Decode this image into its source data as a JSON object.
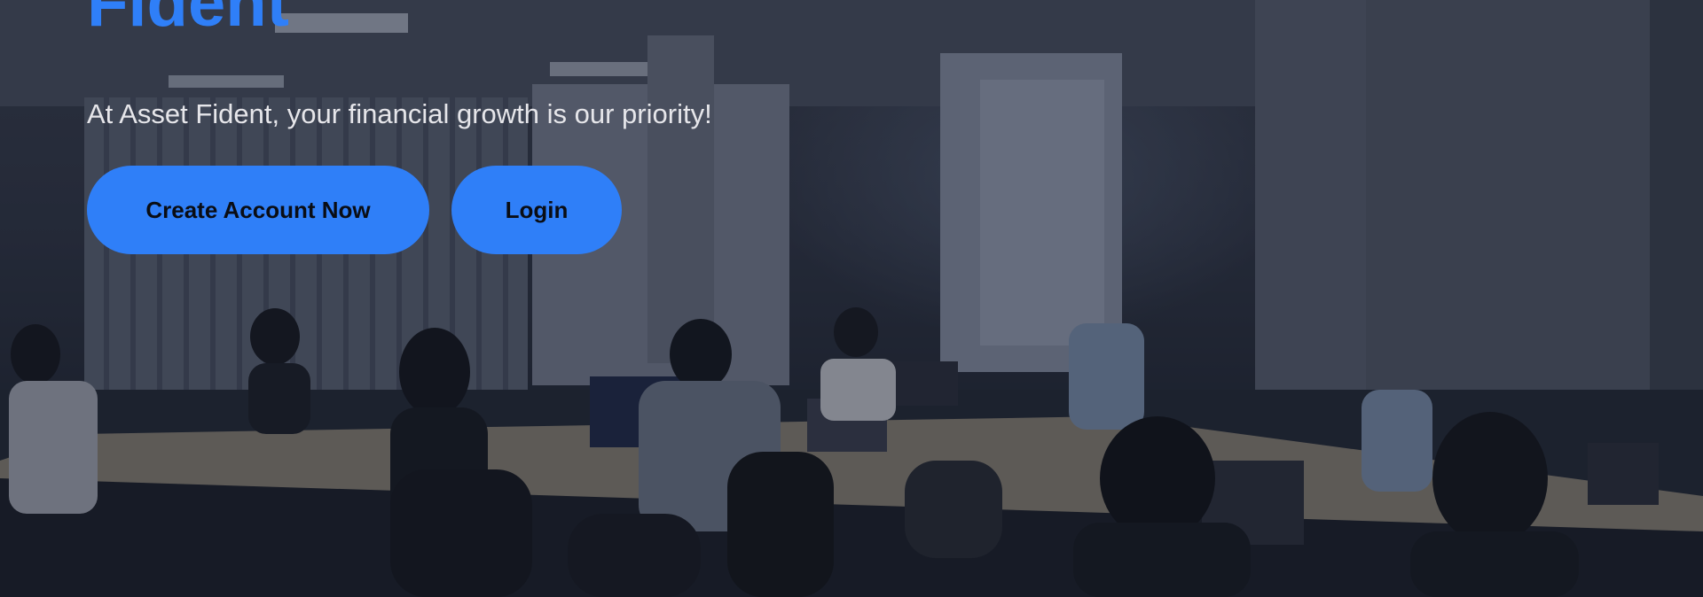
{
  "hero": {
    "headline": "Fident",
    "tagline": "At Asset Fident, your financial growth is our priority!",
    "create_account_label": "Create Account Now",
    "login_label": "Login"
  },
  "colors": {
    "accent": "#2f7ff8",
    "button_text": "#0a0d14",
    "tagline": "#e6e6ea"
  },
  "background": {
    "icon": "office-photo-background"
  }
}
